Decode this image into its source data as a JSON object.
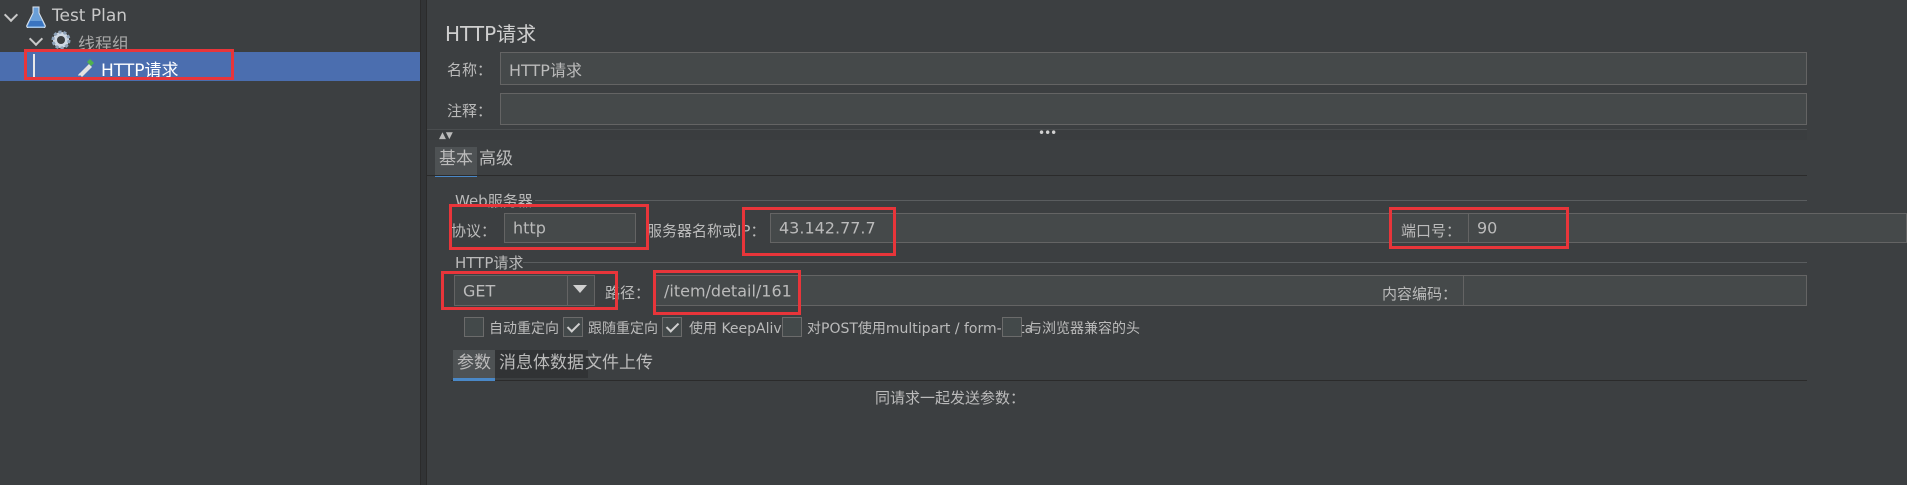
{
  "tree": {
    "items": [
      {
        "label": "Test Plan",
        "icon": "flask-icon"
      },
      {
        "label": "线程组",
        "icon": "gear-icon"
      },
      {
        "label": "HTTP请求",
        "icon": "pipette-icon"
      }
    ]
  },
  "sampler": {
    "title": "HTTP请求",
    "name_label": "名称：",
    "name_value": "HTTP请求",
    "comment_label": "注释：",
    "comment_value": ""
  },
  "tabs": {
    "main": [
      "基本",
      "高级"
    ],
    "active_main": "基本"
  },
  "web_server": {
    "group_title": "Web服务器",
    "protocol_label": "协议：",
    "protocol_value": "http",
    "server_label": "服务器名称或IP：",
    "server_value": "43.142.77.7",
    "port_label": "端口号：",
    "port_value": "90"
  },
  "http_request": {
    "group_title": "HTTP请求",
    "method_value": "GET",
    "path_label": "路径：",
    "path_value": "/item/detail/161",
    "encoding_label": "内容编码："
  },
  "options": [
    {
      "label": "自动重定向",
      "checked": false
    },
    {
      "label": "跟随重定向",
      "checked": true
    },
    {
      "label": "使用 KeepAlive",
      "checked": true
    },
    {
      "label": "对POST使用multipart / form-data",
      "checked": false
    },
    {
      "label": "与浏览器兼容的头",
      "checked": false
    }
  ],
  "sub_tabs": {
    "items": [
      "参数",
      "消息体数据",
      "文件上传"
    ],
    "active": "参数"
  },
  "params_hint": "同请求一起发送参数："
}
